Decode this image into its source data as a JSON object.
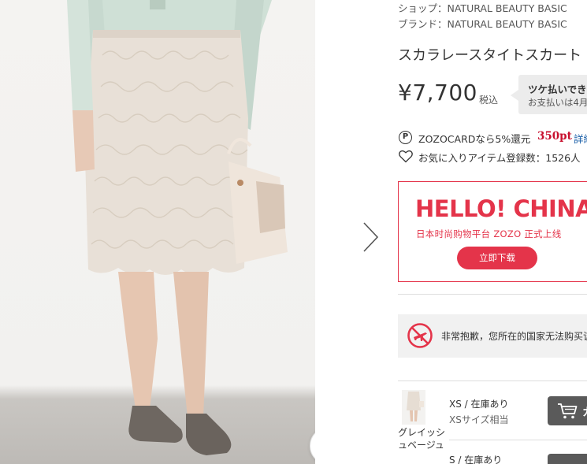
{
  "product": {
    "shop": "ショップ：NATURAL BEAUTY BASIC",
    "brand": "ブランド：NATURAL BEAUTY BASIC",
    "title": "スカラレースタイトスカート",
    "price": "¥7,700",
    "tax_label": "税込"
  },
  "tsuke": {
    "title": "ツケ払いできま",
    "subtitle": "お支払いは4月"
  },
  "zozocard": {
    "icon": "P",
    "text": "ZOZOCARDなら5%還元",
    "points": "350pt",
    "link": "詳細"
  },
  "favorite": {
    "text": "お気に入りアイテム登録数：1526人"
  },
  "banner": {
    "title": "HELLO! CHINA",
    "subtitle": "日本时尚购物平台 ZOZO 正式上线",
    "button": "立即下载",
    "accent": "#e4344a"
  },
  "notice": {
    "text": "非常抱歉，您所在的国家无法购买该"
  },
  "variants": [
    {
      "color": "グレイッシュベージュ",
      "size": "XS / 在庫あり",
      "equiv": "XSサイズ相当",
      "cart_label": "カ"
    },
    {
      "size": "S / 在庫あり"
    }
  ],
  "icons": {
    "zoom": "zoom-in-icon",
    "next": "chevron-right-icon",
    "heart": "heart-icon",
    "no_fly": "no-airplane-icon",
    "cart": "cart-icon"
  }
}
